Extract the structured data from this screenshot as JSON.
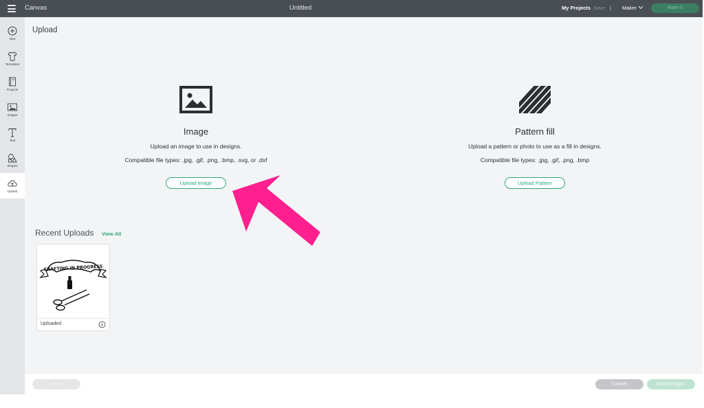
{
  "topbar": {
    "app_name": "Canvas",
    "doc_title": "Untitled",
    "my_projects": "My Projects",
    "save": "Save",
    "separator": "|",
    "machine": "Maker",
    "make_button": "Make it"
  },
  "sidebar": {
    "items": [
      {
        "label": "New",
        "icon": "plus-circle-icon"
      },
      {
        "label": "Templates",
        "icon": "shirt-icon"
      },
      {
        "label": "Projects",
        "icon": "projects-icon"
      },
      {
        "label": "Images",
        "icon": "image-icon"
      },
      {
        "label": "Text",
        "icon": "text-icon"
      },
      {
        "label": "Shapes",
        "icon": "shapes-icon"
      },
      {
        "label": "Upload",
        "icon": "upload-cloud-icon"
      }
    ],
    "active": "Upload"
  },
  "main": {
    "page_title": "Upload",
    "image_section": {
      "title": "Image",
      "description": "Upload an image to use in designs.",
      "file_types": "Compatible file types: .jpg, .gif, .png, .bmp, .svg, or .dxf",
      "button": "Upload Image"
    },
    "pattern_section": {
      "title": "Pattern fill",
      "description": "Upload a pattern or photo to use as a fill in designs.",
      "file_types": "Compatible file types: .jpg, .gif, .png, .bmp",
      "button": "Upload Pattern"
    },
    "recent": {
      "title": "Recent Uploads",
      "view_all": "View All",
      "items": [
        {
          "label": "Uploaded",
          "thumbnail_text": "CRAFTING IN PROGRESS"
        }
      ]
    }
  },
  "footer": {
    "back_button": "Back",
    "cancel_button": "Cancel",
    "insert_button": "Insert Images"
  },
  "colors": {
    "topbar": "#4a4f56",
    "accent_green": "#2fa67a",
    "annotation_arrow": "#ff1f8e"
  }
}
